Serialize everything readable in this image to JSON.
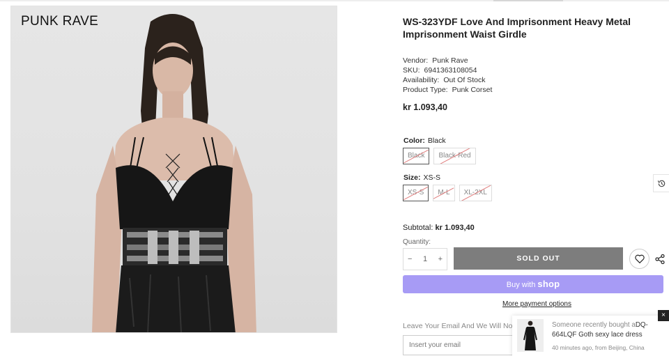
{
  "brand_logo": "PUNK RAVE",
  "product": {
    "title": "WS-323YDF Love And Imprisonment Heavy Metal Imprisonment Waist Girdle",
    "meta": [
      {
        "key": "Vendor:",
        "value": "Punk Rave"
      },
      {
        "key": "SKU:",
        "value": "6941363108054"
      },
      {
        "key": "Availability:",
        "value": "Out Of Stock"
      },
      {
        "key": "Product Type:",
        "value": "Punk Corset"
      }
    ],
    "price": "kr 1.093,40"
  },
  "color": {
    "label": "Color:",
    "selected": "Black",
    "options": [
      "Black",
      "Black-Red"
    ]
  },
  "size": {
    "label": "Size:",
    "selected": "XS-S",
    "options": [
      "XS-S",
      "M-L",
      "XL-2XL"
    ]
  },
  "subtotal": {
    "label": "Subtotal:",
    "value": "kr 1.093,40"
  },
  "quantity": {
    "label": "Quantity:",
    "value": "1",
    "minus": "−",
    "plus": "+"
  },
  "buttons": {
    "sold_out": "SOLD OUT",
    "shop_pay_prefix": "Buy with",
    "shop_pay_brand": "shop",
    "more_payment": "More payment options"
  },
  "notify": {
    "text": "Leave Your Email And We Will Notify A",
    "email_placeholder": "Insert your email"
  },
  "toast": {
    "lead": "Someone recently bought a",
    "product": "DQ-664LQF Goth sexy lace dress",
    "sub": "40 minutes ago, from Beijing, China",
    "close": "×"
  },
  "colors": {
    "sold_out_bg": "#7d7d7d",
    "shop_pay_bg": "#a79bf5",
    "strike": "#e07c7c"
  }
}
